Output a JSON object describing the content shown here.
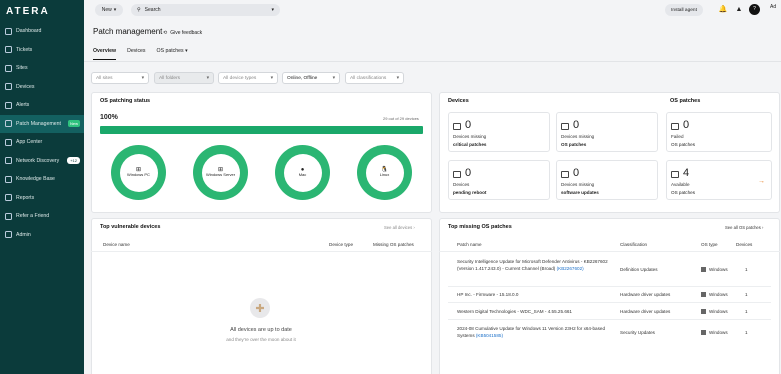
{
  "app": {
    "logo": "ATERA"
  },
  "sidebar": {
    "items": [
      {
        "label": "Dashboard",
        "icon": "dashboard-icon"
      },
      {
        "label": "Tickets",
        "icon": "ticket-icon"
      },
      {
        "label": "Sites",
        "icon": "site-icon"
      },
      {
        "label": "Devices",
        "icon": "device-icon"
      },
      {
        "label": "Alerts",
        "icon": "alert-icon"
      },
      {
        "label": "Patch Management",
        "icon": "patch-icon",
        "badge": "New"
      },
      {
        "label": "App Center",
        "icon": "app-center-icon"
      },
      {
        "label": "Network Discovery",
        "icon": "network-icon",
        "count": "+12"
      },
      {
        "label": "Knowledge Base",
        "icon": "book-icon"
      },
      {
        "label": "Reports",
        "icon": "report-icon"
      },
      {
        "label": "Refer a Friend",
        "icon": "gift-icon"
      },
      {
        "label": "Admin",
        "icon": "admin-icon"
      }
    ],
    "active": "Patch Management"
  },
  "topbar": {
    "new_label": "New",
    "search_placeholder": "Search",
    "install_label": "Install agent",
    "help_label": "?",
    "avatar": "Ad"
  },
  "page": {
    "title": "Patch management",
    "feedback": "Give feedback",
    "tabs": [
      "Overview",
      "Devices",
      "OS patches"
    ]
  },
  "filters": [
    "All sites",
    "All folders",
    "All device types",
    "Online, Offline",
    "All classifications"
  ],
  "os_status": {
    "title": "OS patching status",
    "percent": "100%",
    "percent_value": 100,
    "count": "29 out of 29 devices",
    "donuts": [
      {
        "label": "Windows PC",
        "glyph": "⊞"
      },
      {
        "label": "Windows Server",
        "glyph": "⊞"
      },
      {
        "label": "Mac",
        "glyph": ""
      },
      {
        "label": "Linux",
        "glyph": "🐧"
      }
    ]
  },
  "devices": {
    "title": "Devices",
    "tiles": [
      {
        "num": "0",
        "l1": "Devices missing",
        "l2": "critical patches"
      },
      {
        "num": "0",
        "l1": "Devices missing",
        "l2": "OS patches"
      },
      {
        "num": "0",
        "l1": "Devices",
        "l2": "pending reboot"
      },
      {
        "num": "0",
        "l1": "Devices missing",
        "l2": "software updates"
      }
    ]
  },
  "os_patches": {
    "title": "OS patches",
    "tiles": [
      {
        "num": "0",
        "l1": "Failed",
        "l2": "OS patches"
      },
      {
        "num": "4",
        "l1": "Available",
        "l2": "OS patches"
      }
    ]
  },
  "vulnerable": {
    "title": "Top vulnerable devices",
    "see_all": "See all devices",
    "columns": [
      "Device name",
      "Device type",
      "Missing OS patches"
    ],
    "empty_title": "All devices are up to date",
    "empty_sub": "and they're over the moon about it"
  },
  "missing": {
    "title": "Top missing OS patches",
    "see_all": "See all OS patches",
    "columns": [
      "Patch name",
      "Classification",
      "OS type",
      "Devices"
    ],
    "rows": [
      {
        "name": "Security Intelligence Update for Microsoft Defender Antivirus - KB2267602 (Version 1.417.243.0) - Current Channel (Broad)",
        "kb": "(KB2267602)",
        "class": "Definition Updates",
        "os": "Windows",
        "devices": "1"
      },
      {
        "name": "HP Inc. - Firmware - 15.18.0.0",
        "kb": "",
        "class": "Hardware driver updates",
        "os": "Windows",
        "devices": "1"
      },
      {
        "name": "Western Digital Technologies - WDC_SAM - 4.55.25.661",
        "kb": "",
        "class": "Hardware driver updates",
        "os": "Windows",
        "devices": "1"
      },
      {
        "name": "2024-08 Cumulative Update for Windows 11 Version 23H2 for x64-based Systems",
        "kb": "(KB5041585)",
        "class": "Security Updates",
        "os": "Windows",
        "devices": "1"
      }
    ]
  }
}
